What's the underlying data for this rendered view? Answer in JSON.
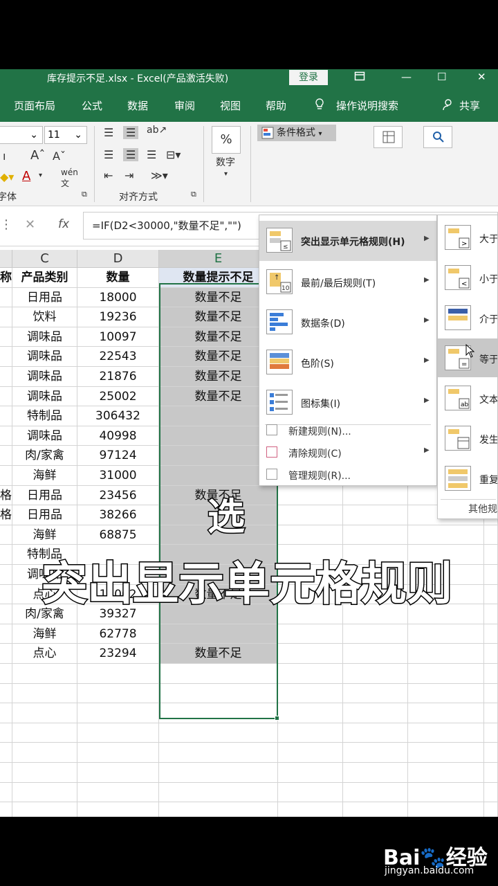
{
  "window": {
    "title": "库存提示不足.xlsx  -  Excel(产品激活失败)",
    "login": "登录",
    "restore_icon": "ribbon-display-icon",
    "minimize": "—",
    "maximize": "☐",
    "close": "✕"
  },
  "tabs": [
    {
      "label": "页面布局"
    },
    {
      "label": "公式"
    },
    {
      "label": "数据"
    },
    {
      "label": "审阅"
    },
    {
      "label": "视图"
    },
    {
      "label": "帮助"
    },
    {
      "label": "操作说明搜索"
    }
  ],
  "share": "共享",
  "ribbon": {
    "font_size": "11",
    "font_group": "字体",
    "align_group": "对齐方式",
    "number_label": "数字",
    "percent": "%",
    "conditional_format": "条件格式"
  },
  "formula": {
    "cancel": "✕",
    "confirm": "✓",
    "fx": "fx",
    "value": "=IF(D2<30000,\"数量不足\",\"\")"
  },
  "columns": [
    "C",
    "D",
    "E"
  ],
  "headers": {
    "b": "称",
    "c": "产品类别",
    "d": "数量",
    "e": "数量提示不足"
  },
  "rows": [
    {
      "b": "",
      "c": "日用品",
      "d": "18000",
      "e": "数量不足"
    },
    {
      "b": "",
      "c": "饮料",
      "d": "19236",
      "e": "数量不足"
    },
    {
      "b": "",
      "c": "调味品",
      "d": "10097",
      "e": "数量不足"
    },
    {
      "b": "",
      "c": "调味品",
      "d": "22543",
      "e": "数量不足"
    },
    {
      "b": "",
      "c": "调味品",
      "d": "21876",
      "e": "数量不足"
    },
    {
      "b": "",
      "c": "调味品",
      "d": "25002",
      "e": "数量不足"
    },
    {
      "b": "",
      "c": "特制品",
      "d": "306432",
      "e": ""
    },
    {
      "b": "",
      "c": "调味品",
      "d": "40998",
      "e": ""
    },
    {
      "b": "",
      "c": "肉/家禽",
      "d": "97124",
      "e": ""
    },
    {
      "b": "",
      "c": "海鲜",
      "d": "31000",
      "e": ""
    },
    {
      "b": "格",
      "c": "日用品",
      "d": "23456",
      "e": "数量不足"
    },
    {
      "b": "格",
      "c": "日用品",
      "d": "38266",
      "e": ""
    },
    {
      "b": "",
      "c": "海鲜",
      "d": "68875",
      "e": ""
    },
    {
      "b": "",
      "c": "特制品",
      "d": "",
      "e": ""
    },
    {
      "b": "",
      "c": "调味品",
      "d": "",
      "e": ""
    },
    {
      "b": "",
      "c": "点心",
      "d": "17002",
      "e": "数量不足"
    },
    {
      "b": "",
      "c": "肉/家禽",
      "d": "39327",
      "e": ""
    },
    {
      "b": "",
      "c": "海鲜",
      "d": "62778",
      "e": ""
    },
    {
      "b": "",
      "c": "点心",
      "d": "23294",
      "e": "数量不足"
    }
  ],
  "menu": {
    "items": [
      {
        "label": "突出显示单元格规则(H)",
        "icon": "highlight-rules-icon"
      },
      {
        "label": "最前/最后规则(T)",
        "icon": "top-bottom-rules-icon"
      },
      {
        "label": "数据条(D)",
        "icon": "data-bars-icon"
      },
      {
        "label": "色阶(S)",
        "icon": "color-scales-icon"
      },
      {
        "label": "图标集(I)",
        "icon": "icon-sets-icon"
      }
    ],
    "small": [
      {
        "label": "新建规则(N)..."
      },
      {
        "label": "清除规则(C)"
      },
      {
        "label": "管理规则(R)..."
      }
    ]
  },
  "submenu": {
    "items": [
      {
        "label": "大于"
      },
      {
        "label": "小于"
      },
      {
        "label": "介于"
      },
      {
        "label": "等于"
      },
      {
        "label": "文本"
      },
      {
        "label": "发生"
      },
      {
        "label": "重复"
      }
    ],
    "more": "其他规"
  },
  "captions": {
    "line1": "选",
    "line2": "突出显示单元格规则"
  },
  "watermark": {
    "main": "Bai🐾经验",
    "sub": "jingyan.baidu.com"
  },
  "colors": {
    "accent": "#217346",
    "selection": "#c8c8c8"
  }
}
